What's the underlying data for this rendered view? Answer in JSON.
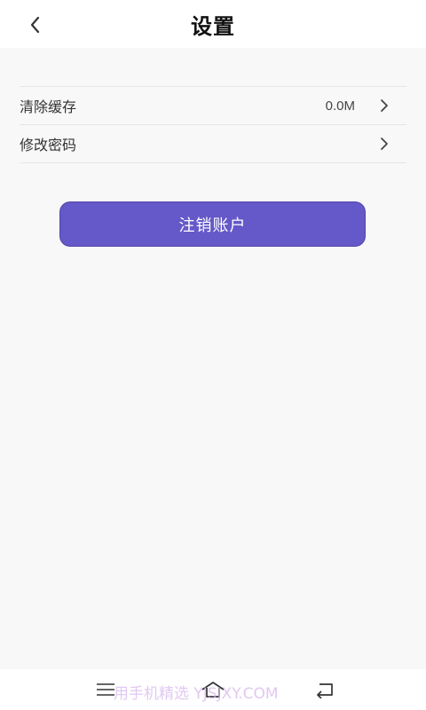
{
  "header": {
    "title": "设置",
    "back_icon": "chevron-left-icon"
  },
  "settings": {
    "items": [
      {
        "label": "清除缓存",
        "value": "0.0M",
        "icon": "chevron-right-icon"
      },
      {
        "label": "修改密码",
        "value": "",
        "icon": "chevron-right-icon"
      }
    ]
  },
  "actions": {
    "logout_label": "注销账户"
  },
  "navbar": {
    "menu_icon": "menu-icon",
    "home_icon": "home-icon",
    "back_icon": "back-icon",
    "watermark": "用手机精选 YJSJXY.COM"
  },
  "colors": {
    "accent": "#6558c8",
    "background": "#f8f8f9"
  }
}
